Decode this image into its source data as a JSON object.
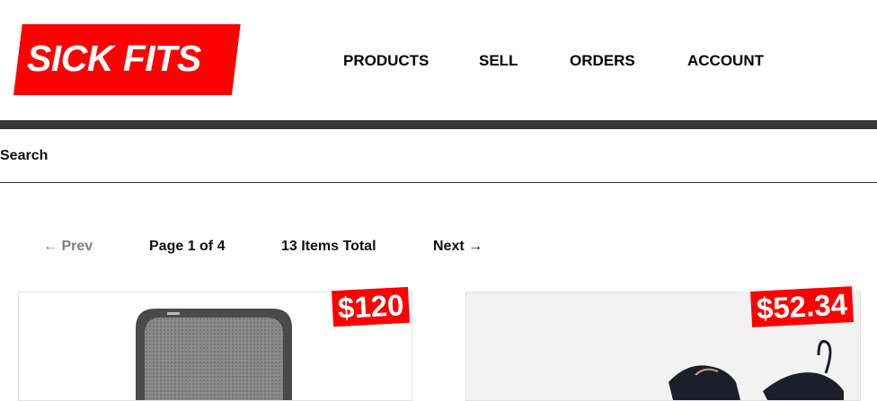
{
  "logo": {
    "text": "SICK FITS"
  },
  "nav": {
    "items": [
      "PRODUCTS",
      "SELL",
      "ORDERS",
      "ACCOUNT"
    ]
  },
  "search": {
    "label": "Search"
  },
  "pagination": {
    "prev_label": "← Prev",
    "page_label": "Page 1 of 4",
    "total_label": "13 Items Total",
    "next_label": "Next →"
  },
  "products": [
    {
      "price": "$120",
      "image_icon": "cooler-bag-icon"
    },
    {
      "price": "$52.34",
      "image_icon": "shoes-icon"
    }
  ],
  "colors": {
    "brand": "#ff0000",
    "bar": "#393939",
    "muted": "#808080"
  }
}
